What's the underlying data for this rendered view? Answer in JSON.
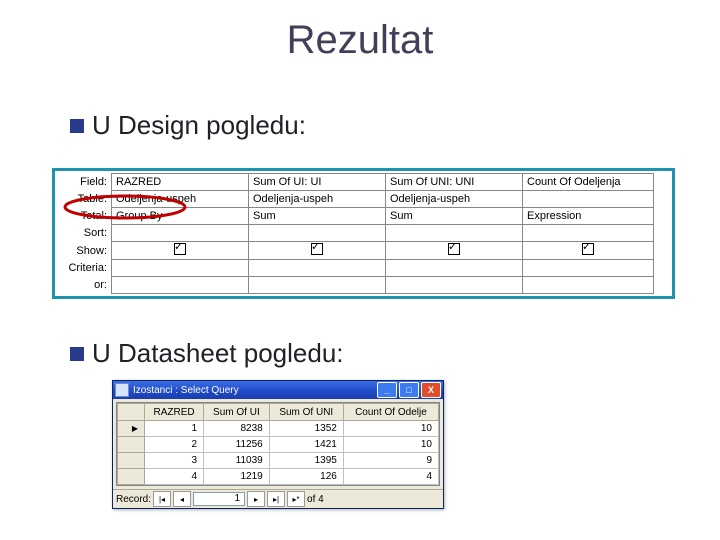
{
  "title": "Rezultat",
  "bullets": {
    "b1": "U Design pogledu:",
    "b2": "U Datasheet pogledu:"
  },
  "design": {
    "row_labels": [
      "Field:",
      "Table:",
      "Total:",
      "Sort:",
      "Show:",
      "Criteria:",
      "or:"
    ],
    "cols": [
      {
        "field": "RAZRED",
        "table": "Odeljenja-uspeh",
        "total": "Group By",
        "show": true
      },
      {
        "field": "Sum Of UI: UI",
        "table": "Odeljenja-uspeh",
        "total": "Sum",
        "show": true
      },
      {
        "field": "Sum Of UNI: UNI",
        "table": "Odeljenja-uspeh",
        "total": "Sum",
        "show": true
      },
      {
        "field": "Count Of Odeljenja",
        "table": "",
        "total": "Expression",
        "show": true
      }
    ]
  },
  "window": {
    "title": "Izostanci : Select Query",
    "headers": [
      "RAZRED",
      "Sum Of UI",
      "Sum Of UNI",
      "Count Of Odelje"
    ],
    "rows": [
      {
        "r": "1",
        "a": "8238",
        "b": "1352",
        "c": "10"
      },
      {
        "r": "2",
        "a": "11256",
        "b": "1421",
        "c": "10"
      },
      {
        "r": "3",
        "a": "11039",
        "b": "1395",
        "c": "9"
      },
      {
        "r": "4",
        "a": "1219",
        "b": "126",
        "c": "4"
      }
    ],
    "record": {
      "label": "Record:",
      "value": "1",
      "of": "of  4",
      "btn_first": "|◂",
      "btn_prev": "◂",
      "btn_next": "▸",
      "btn_last": "▸|",
      "btn_new": "▸*"
    }
  },
  "wb": {
    "min": "_",
    "max": "□",
    "cls": "X"
  }
}
